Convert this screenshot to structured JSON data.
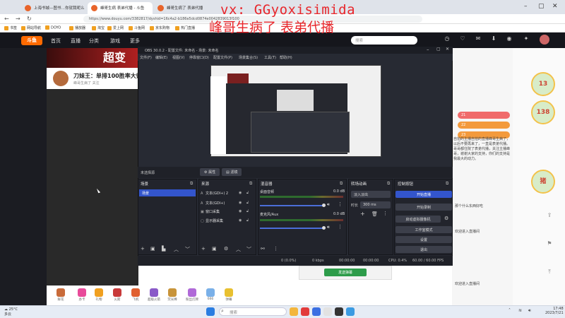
{
  "watermark": {
    "line1": "vx: GGyoxisimida",
    "line2": "峰哥生病了 表弟代播"
  },
  "browser": {
    "tabs": [
      {
        "label": "上海书城—图书…你就我呢么"
      },
      {
        "label": "峰哥生病 表弟代播 - 斗鱼"
      },
      {
        "label": "峰哥生病了 表弟代播"
      }
    ],
    "url": "https://www.douyu.com/3382817/dyshid=16c4a2-b186e5dcd0874e0042839013f100",
    "bookmarks": [
      "书签",
      "网站导航",
      "DOYO",
      "播放器",
      "淘宝",
      "爱上网",
      "斗鱼网",
      "京东购物",
      "热门直播",
      "抖音"
    ]
  },
  "site": {
    "logo": "斗鱼",
    "nav": [
      "首页",
      "直播",
      "分类",
      "游戏",
      "更多"
    ],
    "search_placeholder": "搜索",
    "banner_text": "超变",
    "streamer_name": "刀妹王：单排100胜率大师",
    "streamer_sub": "峰哥生病了  关注",
    "right_ranks": [
      {
        "label": "21",
        "color": "#f06b6b"
      },
      {
        "label": "22",
        "color": "#f39a3c"
      },
      {
        "label": "23",
        "color": "#f39a3c"
      }
    ],
    "badge_labels": [
      "13",
      "138",
      "猪"
    ],
    "chat_text": "自拍的主播自拍的直播峰哥生病了，以后不要再来了，一直是表弟代播。哥哥都住院了表弟代播，关注主播峰哥，谢谢大家的支持，你们的支持是我最大的动力。",
    "chat_lines": [
      "那个什么东西好吃",
      "欢迎进入直播间",
      "欢迎进入直播间"
    ],
    "gifts": [
      "鲜花",
      "办卡",
      "礼物",
      "火箭",
      "飞机",
      "超级火箭",
      "荧光棒",
      "粉丝灯牌",
      "666",
      "弹幕"
    ],
    "bottom_button": "发送弹幕"
  },
  "obs": {
    "title": "OBS 30.0.2 - 配置文件: 未命名 - 场景: 未命名",
    "menu": [
      "文件(F)",
      "编辑(E)",
      "视图(V)",
      "停靠窗口(D)",
      "配置文件(P)",
      "场景集合(S)",
      "工具(T)",
      "帮助(H)"
    ],
    "scene_bar": {
      "label": "未选择源",
      "props": "属性",
      "filters": "滤镜"
    },
    "docks": {
      "scenes": "场景",
      "sources": "来源",
      "mixer": "混音器",
      "transitions": "转场动画",
      "controls": "控制按钮"
    },
    "selected_scene": "场景",
    "sources": [
      {
        "icon": "A",
        "label": "文本(GDI+) 2"
      },
      {
        "icon": "A",
        "label": "文本(GDI+)"
      },
      {
        "icon": "▣",
        "label": "窗口采集"
      },
      {
        "icon": "▢",
        "label": "显示器采集"
      }
    ],
    "mixer": [
      {
        "name": "桌面音频",
        "db": "0.0 dB"
      },
      {
        "name": "麦克风/Aux",
        "db": "0.0 dB"
      }
    ],
    "transition": {
      "type": "淡入淡出",
      "duration_label": "时长",
      "duration": "300 ms"
    },
    "controls": [
      "开始直播",
      "开始录制",
      "启动虚拟摄像机",
      "工作室模式",
      "设置",
      "退出"
    ],
    "status": {
      "drops": "0 (0.0%)",
      "rec": "0 kbps",
      "time1": "00:00:00",
      "time2": "00:00:00",
      "cpu": "CPU: 0.4%",
      "fps": "60.00 / 60.00 FPS"
    }
  },
  "taskbar": {
    "weather_temp": "25°C",
    "weather_desc": "多云",
    "search": "搜索",
    "time": "17:48",
    "date": "2023/7/21"
  }
}
